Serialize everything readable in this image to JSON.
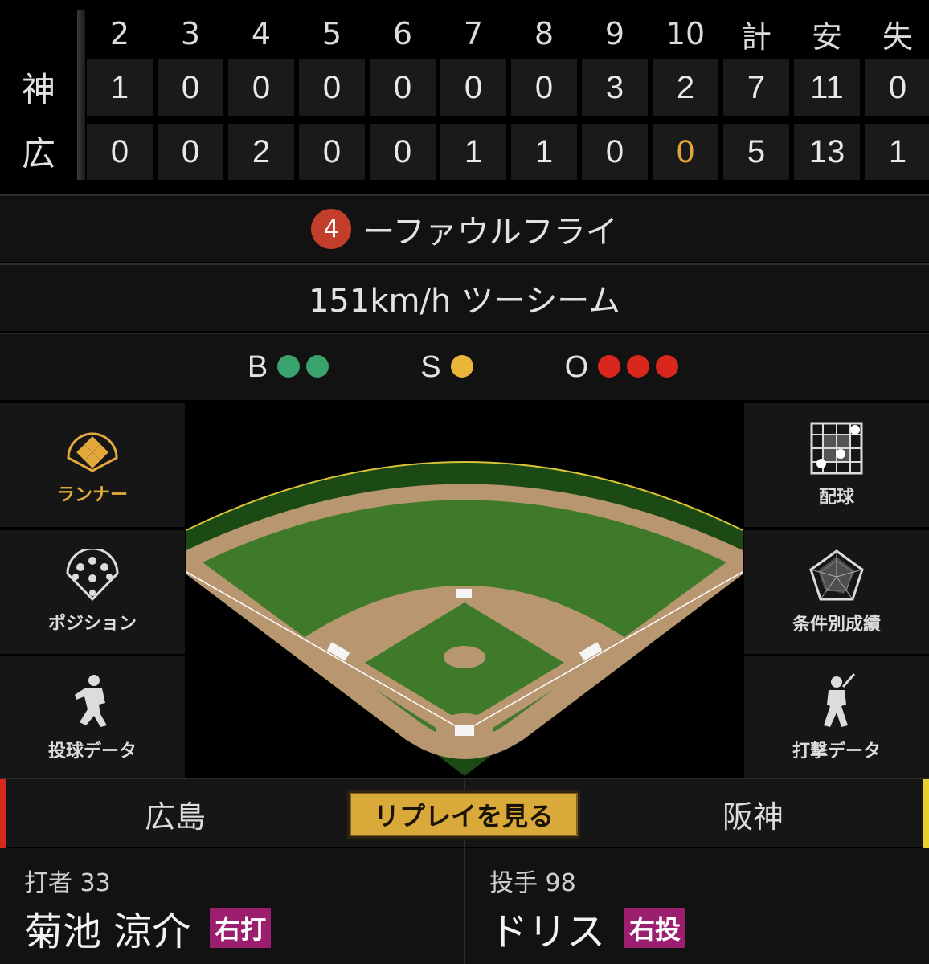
{
  "scoreboard": {
    "headers": [
      "2",
      "3",
      "4",
      "5",
      "6",
      "7",
      "8",
      "9",
      "10",
      "計",
      "安",
      "失"
    ],
    "teams": [
      {
        "abbr": "神",
        "cells": [
          "1",
          "0",
          "0",
          "0",
          "0",
          "0",
          "0",
          "3",
          "2",
          "7",
          "11",
          "0"
        ]
      },
      {
        "abbr": "広",
        "cells": [
          "0",
          "0",
          "2",
          "0",
          "0",
          "1",
          "1",
          "0",
          "0",
          "5",
          "13",
          "1"
        ]
      }
    ],
    "highlight_color": "#e8a33a"
  },
  "play": {
    "position_number": "4",
    "result": "ーファウルフライ"
  },
  "pitch": {
    "text": "151km/h ツーシーム"
  },
  "count": {
    "balls": {
      "label": "B",
      "value": 2,
      "color": "#3aa26d"
    },
    "strikes": {
      "label": "S",
      "value": 1,
      "color": "#e8b73a"
    },
    "outs": {
      "label": "O",
      "value": 3,
      "color": "#d9271e"
    }
  },
  "left_menu": [
    {
      "label": "ランナー",
      "icon": "runner-diamond-icon",
      "active": true
    },
    {
      "label": "ポジション",
      "icon": "position-icon",
      "active": false
    },
    {
      "label": "投球データ",
      "icon": "pitcher-icon",
      "active": false
    }
  ],
  "right_menu": [
    {
      "label": "配球",
      "icon": "pitch-grid-icon"
    },
    {
      "label": "条件別成績",
      "icon": "radar-chart-icon"
    },
    {
      "label": "打撃データ",
      "icon": "batter-icon"
    }
  ],
  "tabs": {
    "left": "広島",
    "replay": "リプレイを見る",
    "right": "阪神"
  },
  "batter": {
    "role_number": "打者 33",
    "name": "菊池 涼介",
    "hand": "右打"
  },
  "pitcher": {
    "role_number": "投手 98",
    "name": "ドリス",
    "hand": "右投"
  }
}
